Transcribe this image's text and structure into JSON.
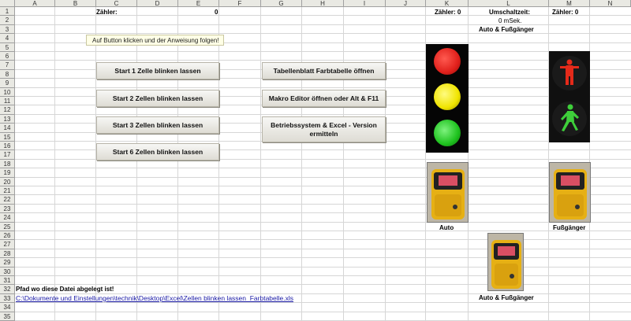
{
  "columns": [
    "A",
    "B",
    "C",
    "D",
    "E",
    "F",
    "G",
    "H",
    "I",
    "J",
    "K",
    "L",
    "M",
    "N"
  ],
  "rows": [
    "1",
    "2",
    "3",
    "4",
    "5",
    "6",
    "7",
    "8",
    "9",
    "10",
    "11",
    "12",
    "13",
    "14",
    "15",
    "16",
    "17",
    "18",
    "19",
    "20",
    "21",
    "22",
    "23",
    "24",
    "25",
    "26",
    "27",
    "28",
    "29",
    "30",
    "31",
    "32",
    "33",
    "34",
    "35"
  ],
  "cells": {
    "zaehler_label": "Zähler:",
    "zaehler_value": "0",
    "k_zaehler": "Zähler:  0",
    "m_zaehler": "Zähler:  0",
    "umschaltzeit": "Umschaltzeit:",
    "umschaltzeit_value": "0 mSek.",
    "auto_fussgaenger_top": "Auto & Fußgänger",
    "auto_label": "Auto",
    "fussgaenger_label": "Fußgänger",
    "auto_fussgaenger_bottom": "Auto & Fußgänger",
    "pfad_label": "Pfad wo diese Datei abgelegt ist!",
    "pfad_link": "C:\\Dokumente und Einstellungen\\technik\\Desktop\\Excel\\Zellen blinken lassen_Farbtabelle.xls"
  },
  "note": "Auf Button klicken und der Anweisung folgen!",
  "buttons": {
    "start1": "Start 1 Zelle blinken lassen",
    "start2": "Start 2 Zellen blinken lassen",
    "start3": "Start 3 Zellen blinken lassen",
    "start6": "Start 6 Zellen blinken lassen",
    "farbtabelle": "Tabellenblatt Farbtabelle öffnen",
    "makro": "Makro Editor öffnen oder Alt & F11",
    "version": "Betriebssystem & Excel - Version ermitteln"
  },
  "colors": {
    "red": "#e0201b",
    "yellow": "#f0e400",
    "green": "#1ec21e",
    "ped_red": "#e52a1a",
    "ped_green": "#3ecf3a",
    "link": "#1a1aa6"
  },
  "icons": {
    "car_traffic_light": "traffic-light-icon",
    "pedestrian_light": "pedestrian-light-icon",
    "push_button": "pedestrian-push-button-icon"
  }
}
